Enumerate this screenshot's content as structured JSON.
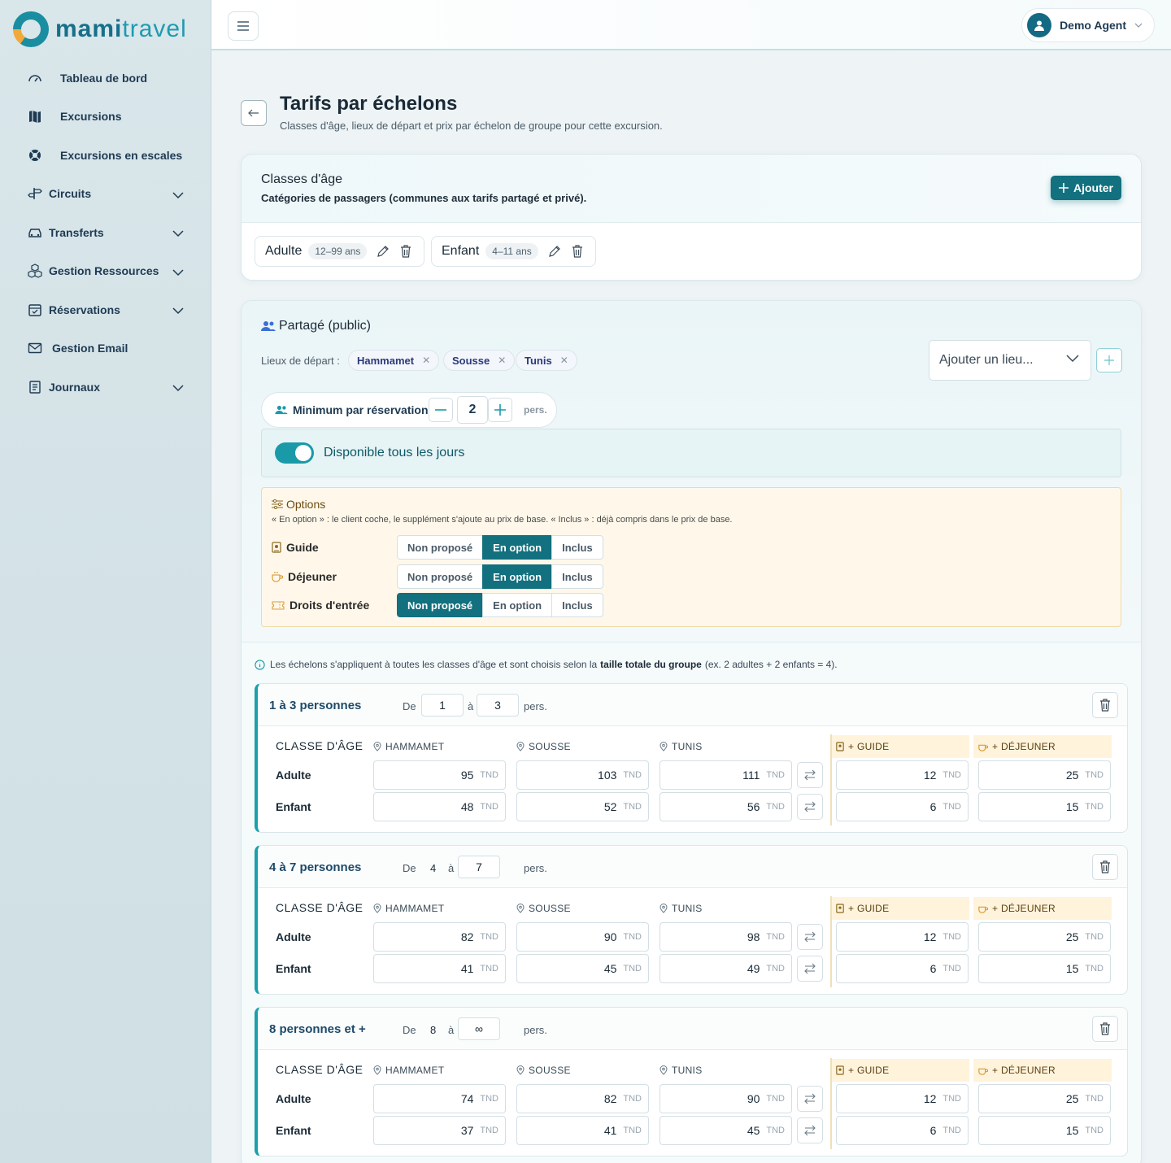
{
  "brand": {
    "name_a": "mami",
    "name_b": "travel"
  },
  "sidebar": {
    "items": [
      {
        "label": "Tableau de bord",
        "icon": "dashboard-icon",
        "expandable": false
      },
      {
        "label": "Excursions",
        "icon": "map-icon",
        "expandable": false
      },
      {
        "label": "Excursions en escales",
        "icon": "lifebuoy-icon",
        "expandable": false
      },
      {
        "label": "Circuits",
        "icon": "signpost-icon",
        "expandable": true
      },
      {
        "label": "Transferts",
        "icon": "car-icon",
        "expandable": true
      },
      {
        "label": "Gestion Ressources",
        "icon": "boxes-icon",
        "expandable": true
      },
      {
        "label": "Réservations",
        "icon": "calendar-check-icon",
        "expandable": true
      },
      {
        "label": "Gestion Email",
        "icon": "envelope-icon",
        "expandable": false
      },
      {
        "label": "Journaux",
        "icon": "journal-icon",
        "expandable": true
      }
    ]
  },
  "topbar": {
    "user_name": "Demo Agent"
  },
  "page": {
    "title": "Tarifs par échelons",
    "subtitle": "Classes d'âge, lieux de départ et prix par échelon de groupe pour cette excursion."
  },
  "age_classes": {
    "title": "Classes d'âge",
    "subtitle": "Catégories de passagers (communes aux tarifs partagé et privé).",
    "add_label": "Ajouter",
    "items": [
      {
        "name": "Adulte",
        "range": "12–99 ans"
      },
      {
        "name": "Enfant",
        "range": "4–11 ans"
      }
    ]
  },
  "shared": {
    "title": "Partagé (public)",
    "lieux_label": "Lieux de départ :",
    "lieux": [
      "Hammamet",
      "Sousse",
      "Tunis"
    ],
    "lieu_placeholder": "Ajouter un lieu...",
    "min_label": "Minimum par réservation",
    "min_value": "2",
    "min_unit": "pers.",
    "dispo_label": "Disponible tous les jours",
    "dispo_on": true
  },
  "options": {
    "title": "Options",
    "desc": "« En option » : le client coche, le supplément s'ajoute au prix de base. « Inclus » : déjà compris dans le prix de base.",
    "choices": [
      "Non proposé",
      "En option",
      "Inclus"
    ],
    "rows": [
      {
        "label": "Guide",
        "icon": "guide-badge-icon",
        "selected": 1
      },
      {
        "label": "Déjeuner",
        "icon": "coffee-cup-icon",
        "selected": 1
      },
      {
        "label": "Droits d'entrée",
        "icon": "ticket-icon",
        "selected": 0
      }
    ]
  },
  "info": {
    "pre": "Les échelons s'appliquent à toutes les classes d'âge et sont choisis selon la",
    "bold": "taille totale du groupe",
    "post": "(ex. 2 adultes + 2 enfants = 4)."
  },
  "tier_labels": {
    "de": "De",
    "a": "à",
    "pers": "pers.",
    "cls": "CLASSE D'ÂGE",
    "hammamet": "HAMMAMET",
    "sousse": "SOUSSE",
    "tunis": "TUNIS",
    "guide": "+ GUIDE",
    "dejeuner": "+ DÉJEUNER",
    "currency": "TND"
  },
  "tiers": [
    {
      "name": "1 à 3 personnes",
      "from": "1",
      "to": "3",
      "rows": [
        {
          "label": "Adulte",
          "hammamet": "95",
          "sousse": "103",
          "tunis": "111",
          "guide": "12",
          "dejeuner": "25"
        },
        {
          "label": "Enfant",
          "hammamet": "48",
          "sousse": "52",
          "tunis": "56",
          "guide": "6",
          "dejeuner": "15"
        }
      ]
    },
    {
      "name": "4 à 7 personnes",
      "from": "4",
      "to": "7",
      "rows": [
        {
          "label": "Adulte",
          "hammamet": "82",
          "sousse": "90",
          "tunis": "98",
          "guide": "12",
          "dejeuner": "25"
        },
        {
          "label": "Enfant",
          "hammamet": "41",
          "sousse": "45",
          "tunis": "49",
          "guide": "6",
          "dejeuner": "15"
        }
      ]
    },
    {
      "name": "8 personnes et +",
      "from": "8",
      "to": "∞",
      "rows": [
        {
          "label": "Adulte",
          "hammamet": "74",
          "sousse": "82",
          "tunis": "90",
          "guide": "12",
          "dejeuner": "25"
        },
        {
          "label": "Enfant",
          "hammamet": "37",
          "sousse": "41",
          "tunis": "45",
          "guide": "6",
          "dejeuner": "15"
        }
      ]
    }
  ]
}
